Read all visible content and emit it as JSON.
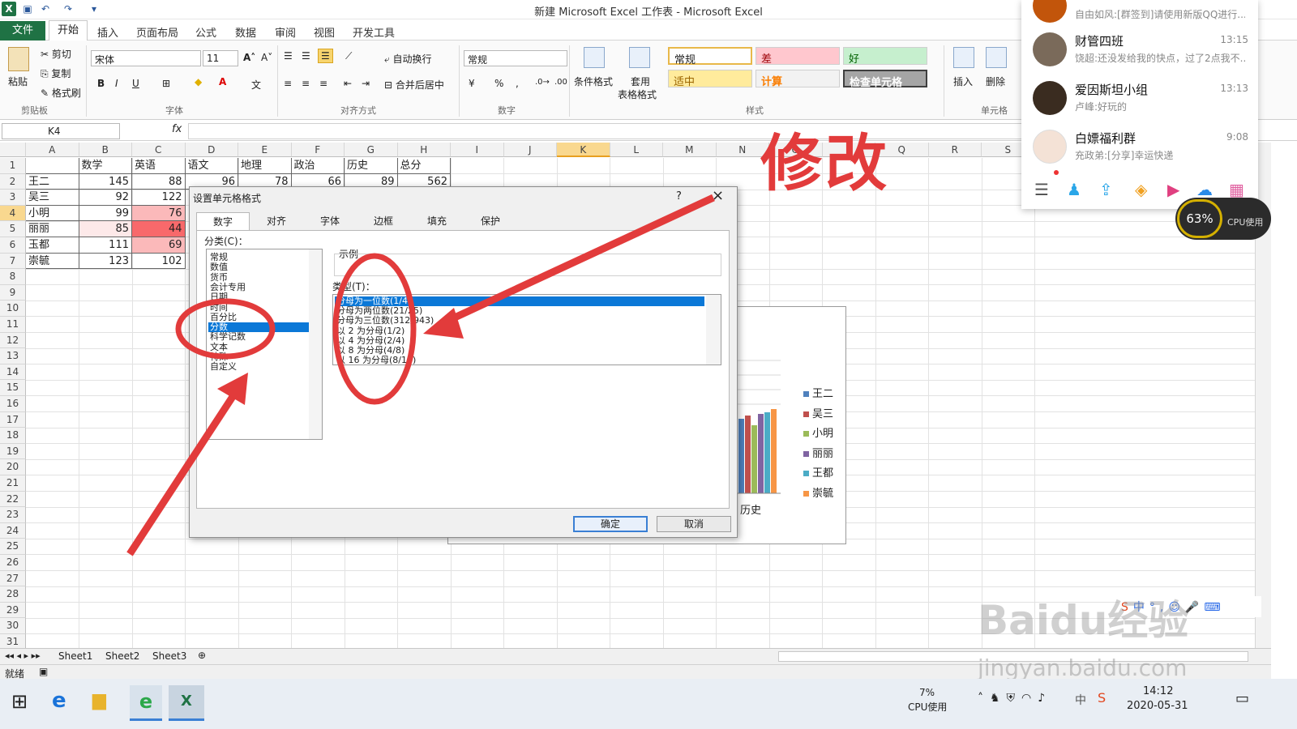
{
  "window": {
    "title": "新建 Microsoft Excel 工作表 - Microsoft Excel"
  },
  "menu": {
    "file": "文件",
    "tabs": [
      "开始",
      "插入",
      "页面布局",
      "公式",
      "数据",
      "审阅",
      "视图",
      "开发工具"
    ]
  },
  "ribbon": {
    "clipboard": {
      "paste": "粘贴",
      "cut": "剪切",
      "copy": "复制",
      "painter": "格式刷",
      "label": "剪贴板"
    },
    "font": {
      "name": "宋体",
      "size": "11",
      "label": "字体",
      "bold": "B",
      "italic": "I",
      "underline": "U"
    },
    "align": {
      "wrap": "自动换行",
      "merge": "合并后居中",
      "label": "对齐方式"
    },
    "number": {
      "format": "常规",
      "percent": "%",
      "comma": ",",
      "label": "数字"
    },
    "styles": {
      "cond": "条件格式",
      "table1": "套用",
      "table2": "表格格式",
      "label": "样式",
      "normal": "常规",
      "bad": "差",
      "good": "好",
      "neutral": "适中",
      "calc": "计算",
      "check": "检查单元格"
    },
    "cells": {
      "insert": "插入",
      "delete": "删除",
      "label": "单元格"
    }
  },
  "formula": {
    "name_box": "K4",
    "fx": "fx"
  },
  "columns": [
    "A",
    "B",
    "C",
    "D",
    "E",
    "F",
    "G",
    "H",
    "I",
    "J",
    "K",
    "L",
    "M",
    "N",
    "O",
    "P",
    "Q",
    "R",
    "S"
  ],
  "rows": [
    "1",
    "2",
    "3",
    "4",
    "5",
    "6",
    "7",
    "8",
    "9",
    "10",
    "11",
    "12",
    "13",
    "14",
    "15",
    "16",
    "17",
    "18",
    "19",
    "20",
    "21",
    "22",
    "23",
    "24",
    "25",
    "26",
    "27",
    "28",
    "29",
    "30",
    "31"
  ],
  "table": {
    "headers": [
      "",
      "数学",
      "英语",
      "语文",
      "地理",
      "政治",
      "历史",
      "总分"
    ],
    "data": [
      {
        "name": "王二",
        "math": "145",
        "english": "88",
        "chinese": "96",
        "geo": "78",
        "pol": "66",
        "hist": "89",
        "total": "562"
      },
      {
        "name": "吴三",
        "math": "92",
        "english": "122"
      },
      {
        "name": "小明",
        "math": "99",
        "english": "76"
      },
      {
        "name": "丽丽",
        "math": "85",
        "english": "44"
      },
      {
        "name": "玉都",
        "math": "111",
        "english": "69"
      },
      {
        "name": "崇毓",
        "math": "123",
        "english": "102"
      }
    ]
  },
  "chart": {
    "category": "历史",
    "legend": [
      "王二",
      "吴三",
      "小明",
      "丽丽",
      "王都",
      "崇毓"
    ],
    "colors": [
      "#4f81bd",
      "#c0504d",
      "#9bbb59",
      "#8064a2",
      "#4bacc6",
      "#f79646"
    ]
  },
  "annotation": {
    "text": "修改"
  },
  "dialog": {
    "title": "设置单元格格式",
    "help": "?",
    "close": "×",
    "tabs": [
      "数字",
      "对齐",
      "字体",
      "边框",
      "填充",
      "保护"
    ],
    "category_label": "分类(C)：",
    "categories": [
      "常规",
      "数值",
      "货币",
      "会计专用",
      "日期",
      "时间",
      "百分比",
      "分数",
      "科学记数",
      "文本",
      "特殊",
      "自定义"
    ],
    "selected_category": "分数",
    "sample_label": "示例",
    "type_label": "类型(T)：",
    "types": [
      "分母为一位数(1/4)",
      "分母为两位数(21/25)",
      "分母为三位数(312/943)",
      "以 2 为分母(1/2)",
      "以 4 为分母(2/4)",
      "以 8 为分母(4/8)",
      "以 16 为分母(8/16)"
    ],
    "ok": "确定",
    "cancel": "取消"
  },
  "sheets": [
    "Sheet1",
    "Sheet2",
    "Sheet3"
  ],
  "status": {
    "ready": "就绪"
  },
  "qq": {
    "items": [
      {
        "name": "",
        "msg": "自由如风:[群签到]请使用新版QQ进行...",
        "time": ""
      },
      {
        "name": "财管四班",
        "msg": "饶超:还没发给我的快点，过了2点我不...",
        "time": "13:15"
      },
      {
        "name": "爱因斯坦小组",
        "msg": "卢峰:好玩的",
        "time": "13:13"
      },
      {
        "name": "白嫖福利群",
        "msg": "充政弟:[分享]幸运快递",
        "time": "9:08"
      }
    ]
  },
  "cpu_widget": {
    "percent": "63%",
    "label": "CPU使用"
  },
  "taskbar": {
    "cpu": "7%",
    "cpu_label": "CPU使用",
    "ime": "中",
    "time": "14:12",
    "date": "2020-05-31"
  },
  "watermark": {
    "brand": "Baidu经验",
    "url": "jingyan.baidu.com"
  }
}
